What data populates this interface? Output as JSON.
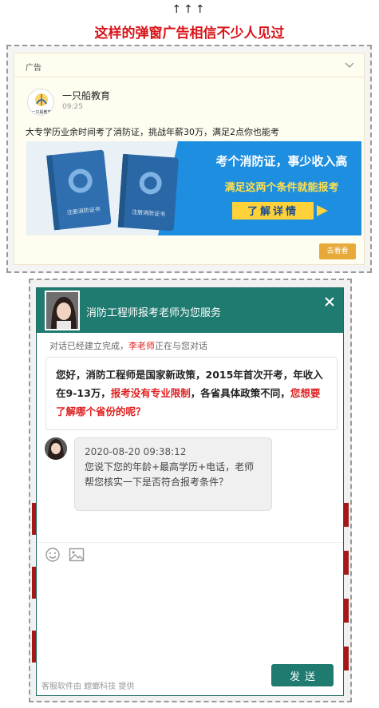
{
  "top": {
    "arrows": "↑↑↑",
    "headline": "这样的弹窗广告相信不少人见过"
  },
  "ad": {
    "tag": "广告",
    "account_name": "一只船教育",
    "logo_text": "一只船教育",
    "time": "09:25",
    "text": "大专学历业余时间考了消防证，挑战年薪30万，满足2点你也能考",
    "banner": {
      "book1_label": "注册消防证书",
      "book2_label": "注册消防证书",
      "line1": "考个消防证，事少收入高",
      "line2": "满足这两个条件就能报考",
      "cta": "了解详情"
    },
    "button": "去看看",
    "icons": [
      "chevron-down-icon"
    ]
  },
  "chat": {
    "title": "消防工程师报考老师为您服务",
    "status_prefix": "对话已经建立完成，",
    "status_agent": "李老师",
    "status_suffix": "正在与您对话",
    "welcome": {
      "part1": "您好，消防工程师是国家新政策，2015年首次开考，年收入在9-13万，",
      "part2": "报考没有专业限制",
      "part3": "，各省具体政策不同，",
      "part4": "您想要了解哪个省份的呢？"
    },
    "message": {
      "timestamp": "2020-08-20 09:38:12",
      "text": "您说下您的年龄+最高学历+电话，老师帮您核实一下是否符合报考条件？"
    },
    "send_label": "发送",
    "footer": "客服软件由 螳螂科技 提供",
    "icons": [
      "close-icon",
      "emoji-icon",
      "image-icon"
    ]
  },
  "colors": {
    "headline_red": "#d9141a",
    "chat_teal": "#1f7a70",
    "ad_button": "#e8a93a",
    "banner_blue": "#1e8ee0",
    "highlight_red": "#e02020"
  }
}
